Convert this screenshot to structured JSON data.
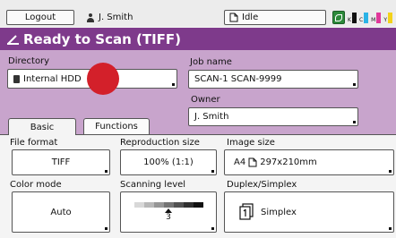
{
  "topbar": {
    "logout_label": "Logout",
    "user": "J. Smith",
    "status": "Idle",
    "toner_labels": [
      "K",
      "C",
      "M",
      "Y"
    ],
    "toner_colors": [
      "#111111",
      "#2bb3e6",
      "#e0389a",
      "#f3d21b"
    ]
  },
  "title": "Ready to Scan (TIFF)",
  "directory": {
    "label": "Directory",
    "value": "Internal HDD"
  },
  "job_name": {
    "label": "Job name",
    "value": "SCAN-1 SCAN-9999"
  },
  "owner": {
    "label": "Owner",
    "value": "J. Smith"
  },
  "tabs": [
    {
      "label": "Basic",
      "active": true
    },
    {
      "label": "Functions",
      "active": false
    }
  ],
  "settings": {
    "file_format": {
      "label": "File format",
      "value": "TIFF"
    },
    "reproduction_size": {
      "label": "Reproduction size",
      "value": "100% (1:1)"
    },
    "image_size": {
      "label": "Image size",
      "value": "A4",
      "dimensions": "297x210mm"
    },
    "color_mode": {
      "label": "Color mode",
      "value": "Auto"
    },
    "scanning_level": {
      "label": "Scanning level",
      "value": "3"
    },
    "duplex_simplex": {
      "label": "Duplex/Simplex",
      "value": "Simplex"
    }
  },
  "colors": {
    "title_bar": "#7e3a8b",
    "panel": "#c8a4cc",
    "marker_dot": "#d3202a"
  }
}
